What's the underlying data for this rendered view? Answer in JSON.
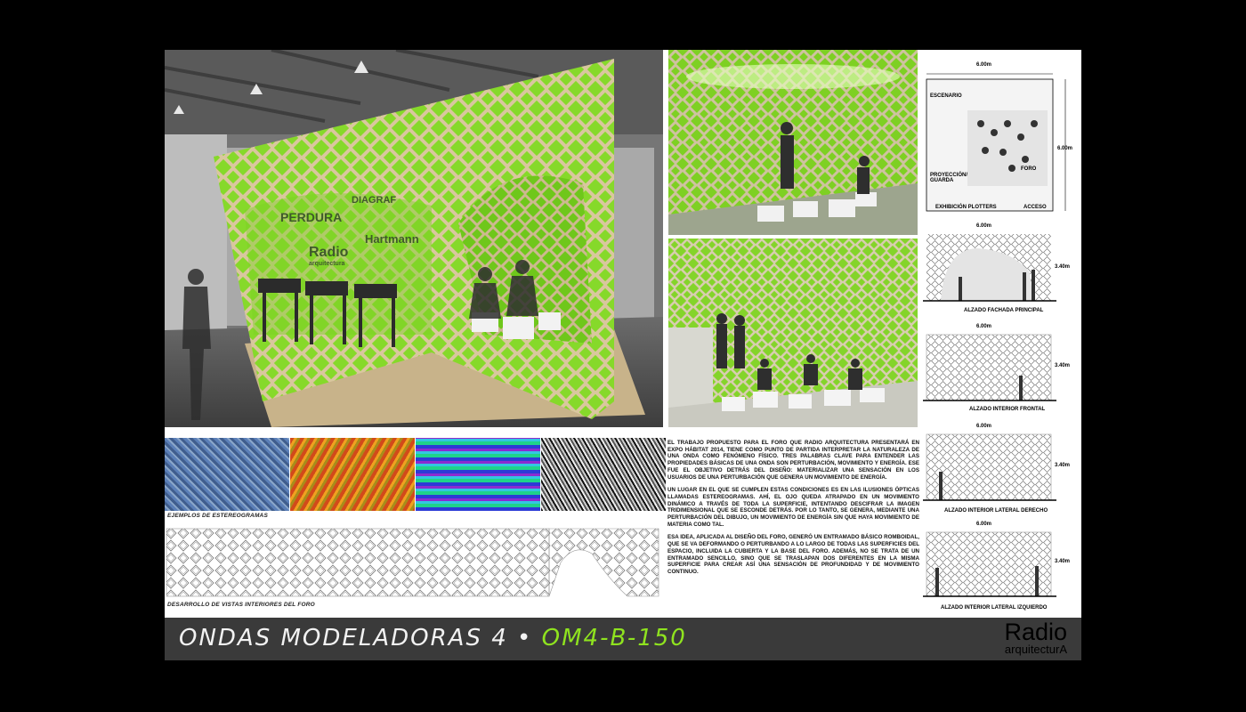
{
  "board": {
    "captions": {
      "stereograms": "EJEMPLOS DE ESTEREOGRAMAS",
      "development": "DESARROLLO DE VISTAS INTERIORES DEL FORO"
    },
    "description": [
      "EL TRABAJO PROPUESTO PARA EL FORO QUE RADIO ARQUITECTURA PRESENTARÁ EN EXPO HÁBITAT 2014, TIENE COMO PUNTO DE PARTIDA INTERPRETAR LA NATURALEZA DE UNA ONDA COMO FENÓMENO FÍSICO. TRES PALABRAS CLAVE PARA ENTENDER LAS PROPIEDADES BÁSICAS DE UNA ONDA SON PERTURBACIÓN, MOVIMIENTO Y ENERGÍA. ESE FUE EL OBJETIVO DETRÁS DEL DISEÑO: MATERIALIZAR UNA SENSACIÓN EN LOS USUARIOS DE UNA PERTURBACIÓN QUE GENERA UN MOVIMIENTO DE ENERGÍA.",
      "UN LUGAR EN EL QUE SE CUMPLEN ESTAS CONDICIONES ES EN LAS ILUSIONES ÓPTICAS LLAMADAS ESTEREOGRAMAS. AHÍ, EL OJO QUEDA ATRAPADO EN UN MOVIMIENTO DINÁMICO A TRAVÉS DE TODA LA SUPERFICIE, INTENTANDO DESCIFRAR LA IMAGEN TRIDIMENSIONAL QUE SE ESCONDE DETRÁS. POR LO TANTO, SE GENERA, MEDIANTE UNA PERTURBACIÓN DEL DIBUJO, UN MOVIMIENTO DE ENERGÍA SIN QUE HAYA MOVIMIENTO DE MATERIA COMO TAL.",
      "ESA IDEA, APLICADA AL DISEÑO DEL FORO, GENERÓ UN ENTRAMADO BÁSICO ROMBOIDAL, QUE SE VA DEFORMANDO O PERTURBANDO A LO LARGO DE TODAS LAS SUPERFICIES DEL ESPACIO, INCLUIDA LA CUBIERTA Y LA BASE DEL FORO. ADEMÁS, NO SE TRATA DE UN ENTRAMADO SENCILLO, SINO QUE SE TRASLAPAN DOS DIFERENTES EN LA MISMA SUPERFICIE PARA CREAR ASÍ UNA SENSACIÓN DE PROFUNDIDAD Y DE MOVIMIENTO CONTINUO."
    ],
    "plan": {
      "width": "6.00m",
      "depth": "6.00m",
      "labels": [
        "ESCENARIO",
        "FORO",
        "PROYECCIÓN/ GUARDA",
        "EXHIBICIÓN PLOTTERS",
        "ACCESO"
      ]
    },
    "elevations": [
      {
        "title": "ALZADO FACHADA PRINCIPAL",
        "width": "6.00m",
        "height": "3.40m"
      },
      {
        "title": "ALZADO INTERIOR FRONTAL",
        "width": "6.00m",
        "height": "3.40m"
      },
      {
        "title": "ALZADO INTERIOR LATERAL DERECHO",
        "width": "6.00m",
        "height": "3.40m"
      },
      {
        "title": "ALZADO INTERIOR LATERAL IZQUIERDO",
        "width": "6.00m",
        "height": "3.40m"
      }
    ],
    "render_signage": [
      "PERDURA",
      "Radio",
      "arquitectura",
      "DIAGRAF",
      "Hartmann"
    ]
  },
  "footer": {
    "title": "ONDAS MODELADORAS 4",
    "separator": " • ",
    "code": "OM4-B-150",
    "logo_line1": "Radio",
    "logo_line2": "arquitecturA"
  },
  "colors": {
    "lattice_green": "#7fd321",
    "wood": "#c9b48c",
    "footer_bg": "#3a3a3a",
    "code_accent": "#8fe31f"
  }
}
